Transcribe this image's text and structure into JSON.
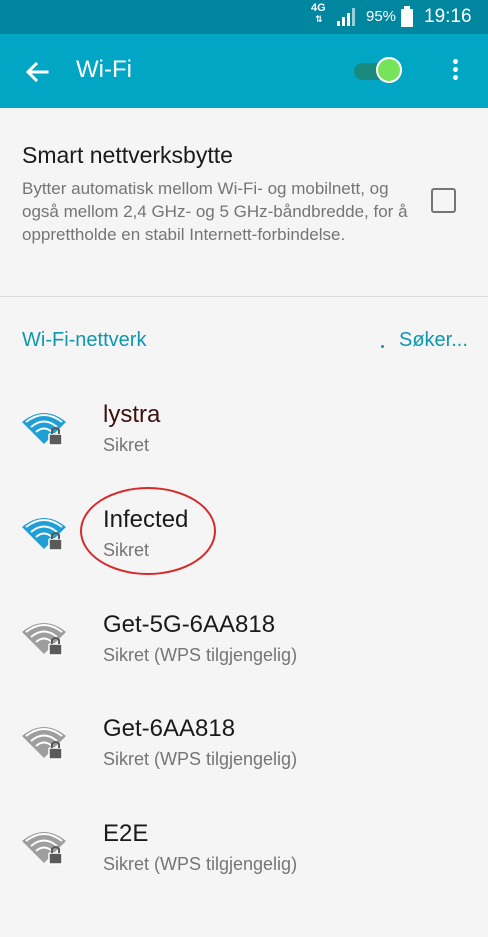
{
  "status_bar": {
    "network_type": "4G",
    "battery_percent": "95%",
    "time": "19:16",
    "icons": [
      "data-arrows-icon",
      "signal-icon",
      "battery-icon"
    ]
  },
  "app_bar": {
    "title": "Wi-Fi",
    "wifi_enabled": true,
    "icons": [
      "back-arrow-icon",
      "more-vert-icon"
    ]
  },
  "smart_switch": {
    "title": "Smart nettverksbytte",
    "description": "Bytter automatisk mellom Wi-Fi- og mobilnett, og også mellom 2,4 GHz- og 5 GHz-båndbredde, for å opprettholde en stabil Internett-forbindelse.",
    "checked": false
  },
  "networks_section": {
    "title": "Wi-Fi-nettverk",
    "scan_status": "Søker..."
  },
  "networks": [
    {
      "name": "lystra",
      "status": "Sikret",
      "signal": "strong",
      "secured": true
    },
    {
      "name": "Infected",
      "status": "Sikret",
      "signal": "strong",
      "secured": true
    },
    {
      "name": "Get-5G-6AA818",
      "status": "Sikret (WPS tilgjengelig)",
      "signal": "weak",
      "secured": true
    },
    {
      "name": "Get-6AA818",
      "status": "Sikret (WPS tilgjengelig)",
      "signal": "weak",
      "secured": true
    },
    {
      "name": "E2E",
      "status": "Sikret (WPS tilgjengelig)",
      "signal": "weak",
      "secured": true
    }
  ],
  "colors": {
    "status_bar": "#00879f",
    "app_bar": "#00a6c4",
    "accent": "#0f97b0",
    "toggle_on": "#76e45a",
    "wifi_strong": "#1f9fd6",
    "wifi_weak": "#9e9e9e",
    "annotation": "#d62a2a"
  }
}
